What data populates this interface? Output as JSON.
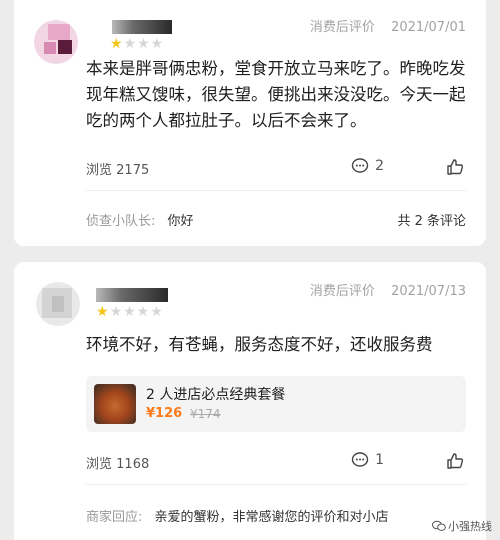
{
  "reviews": [
    {
      "meta_label": "消费后评价",
      "date": "2021/07/01",
      "stars": "★★★★★",
      "text": "本来是胖哥俩忠粉，堂食开放立马来吃了。昨晚吃发现年糕又馊味，很失望。便挑出来没没吃。今天一起吃的两个人都拉肚子。以后不会来了。",
      "views_label": "浏览",
      "views": "2175",
      "comment_count": "2",
      "reply_label": "侦查小队长:",
      "reply_text": "你好",
      "reply_total": "共 2 条评论"
    },
    {
      "meta_label": "消费后评价",
      "date": "2021/07/13",
      "stars": "★★★★★",
      "text": "环境不好，有苍蝇，服务态度不好，还收服务费",
      "combo_title": "2 人进店必点经典套餐",
      "combo_price": "¥126",
      "combo_orig": "¥174",
      "views_label": "浏览",
      "views": "1168",
      "comment_count": "1",
      "reply_label": "商家回应:",
      "reply_text": "亲爱的蟹粉，非常感谢您的评价和对小店"
    }
  ],
  "watermark": "小强热线",
  "colors": {
    "accent": "#ff7a1a",
    "star": "#f5c518",
    "muted": "#a3a3a3"
  }
}
